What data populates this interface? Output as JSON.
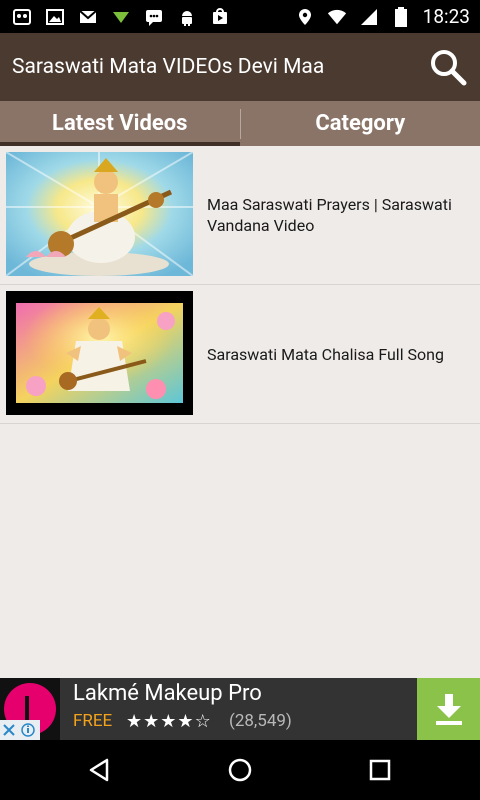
{
  "status_bar": {
    "time": "18:23",
    "left_icons": [
      "notification-icon",
      "image-icon",
      "gmail-icon",
      "signal-app-icon",
      "chat-icon",
      "android-icon",
      "play-store-icon"
    ],
    "right_icons": [
      "location-icon",
      "wifi-icon",
      "signal-icon",
      "battery-icon"
    ]
  },
  "app_bar": {
    "title": "Saraswati Mata VIDEOs Devi Maa"
  },
  "tabs": [
    {
      "label": "Latest Videos",
      "active": true
    },
    {
      "label": "Category",
      "active": false
    }
  ],
  "videos": [
    {
      "title": "Maa Saraswati Prayers | Saraswati Vandana Video"
    },
    {
      "title": "Saraswati Mata Chalisa Full Song"
    }
  ],
  "ad": {
    "app_name": "Lakmé Makeup Pro",
    "price": "FREE",
    "rating": 4.5,
    "review_count": "(28,549)"
  },
  "colors": {
    "action_bar": "#4a3a30",
    "tab_bar": "#8a7468",
    "background": "#efebe8",
    "ad_download": "#8bc34a",
    "ad_price": "#f4a21c"
  }
}
